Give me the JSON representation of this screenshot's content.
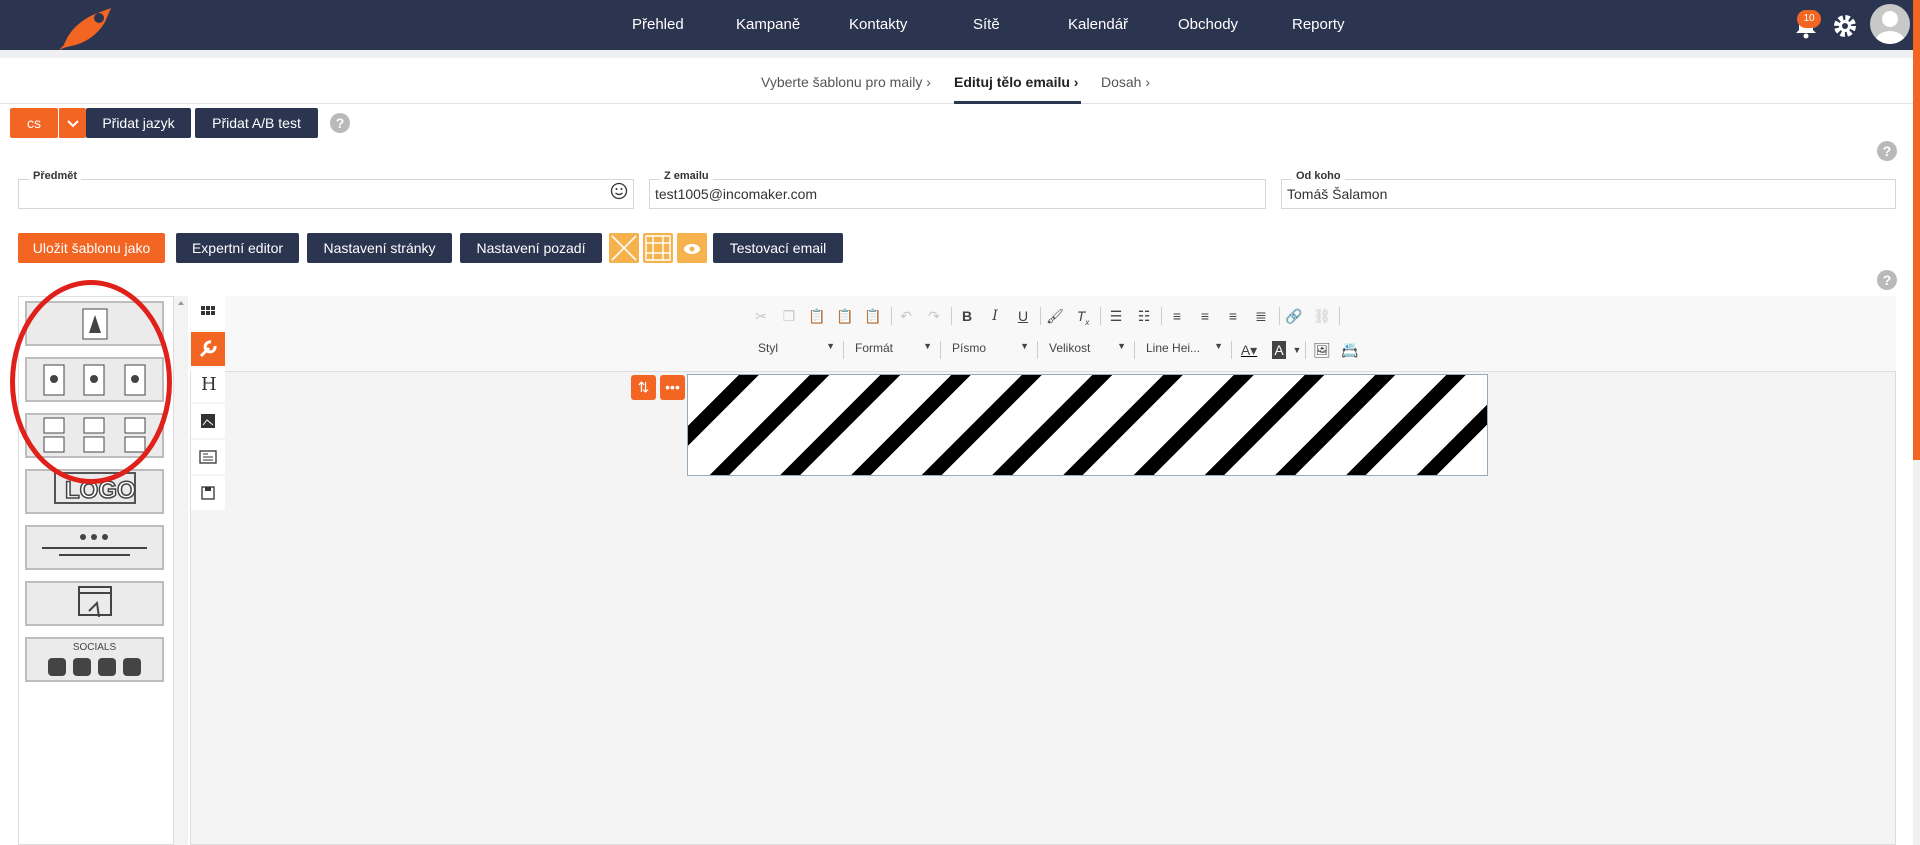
{
  "nav": {
    "items": [
      "Přehled",
      "Kampaně",
      "Kontakty",
      "Sítě",
      "Kalendář",
      "Obchody",
      "Reporty"
    ],
    "notification_count": "10"
  },
  "steps": [
    "Vyberte šablonu pro maily",
    "Edituj tělo emailu",
    "Dosah"
  ],
  "lang": {
    "selected": "cs",
    "add_language": "Přidat jazyk",
    "add_ab_test": "Přidat A/B test"
  },
  "fields": {
    "subject_label": "Předmět",
    "subject_value": "",
    "from_email_label": "Z emailu",
    "from_email_value": "test1005@incomaker.com",
    "from_name_label": "Od koho",
    "from_name_value": "Tomáš Šalamon"
  },
  "actions": {
    "save_as_template": "Uložit šablonu jako",
    "expert_editor": "Expertní editor",
    "page_settings": "Nastavení stránky",
    "background_settings": "Nastavení pozadí",
    "test_email": "Testovací email"
  },
  "toolbar": {
    "styles": "Styl",
    "format": "Formát",
    "font": "Písmo",
    "size": "Velikost",
    "line_height": "Line Hei..."
  },
  "blocks": {
    "logo_label": "LOGO",
    "socials_label": "SOCIALS"
  },
  "help_symbol": "?",
  "colors": {
    "navy": "#2b3550",
    "orange": "#f26522",
    "annotation_red": "#e0201b"
  }
}
